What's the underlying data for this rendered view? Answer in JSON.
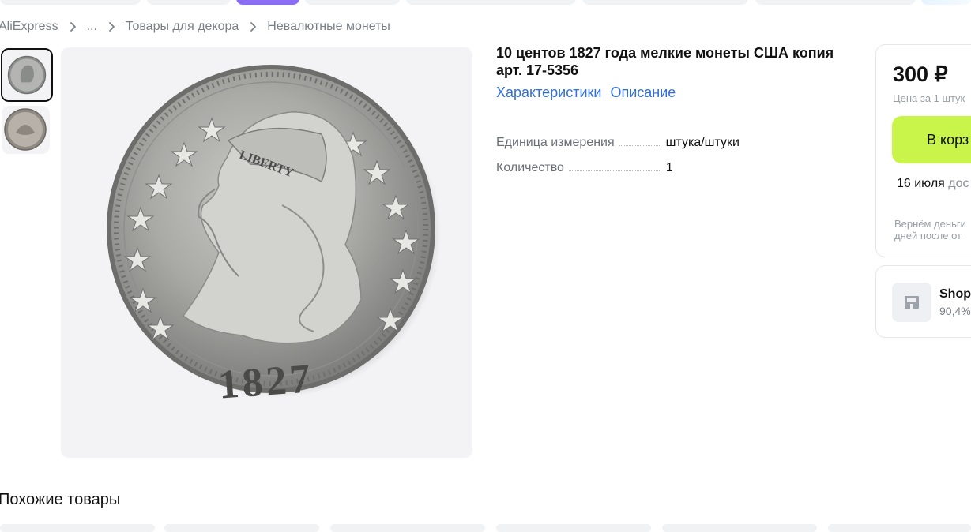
{
  "breadcrumb": {
    "items": [
      "AliExpress",
      "...",
      "Товары для декора",
      "Невалютные монеты"
    ]
  },
  "main_image": {
    "year": "1827",
    "inscription": "LIBERTY"
  },
  "product": {
    "title": "10 центов 1827 года мелкие монеты США копия арт. 17-5356",
    "tabs": [
      "Характеристики",
      "Описание"
    ],
    "specs": [
      {
        "key": "Единица измерения",
        "value": "штука/штуки"
      },
      {
        "key": "Количество",
        "value": "1"
      }
    ]
  },
  "buybox": {
    "price": "300 ₽",
    "unit_price": "Цена за 1 штук",
    "cart_button": "В корз",
    "delivery_date": "16 июля",
    "delivery_suffix": "дос",
    "refund_line1": "Вернём деньги",
    "refund_line2": "дней после от"
  },
  "seller": {
    "name": "Shop",
    "rating": "90,4%"
  },
  "similar": {
    "title": "Похожие товары"
  },
  "colors": {
    "accent_link": "#2f6fe0",
    "cart_button": "#c9f54a",
    "active_chip": "#8a6cf6"
  }
}
